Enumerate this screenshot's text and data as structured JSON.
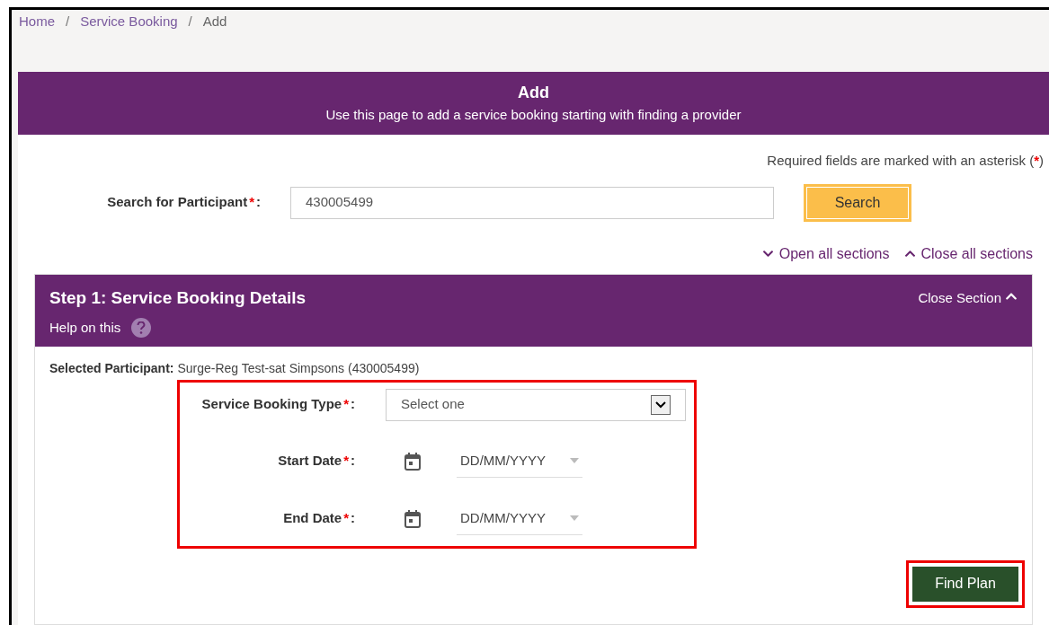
{
  "breadcrumb": [
    {
      "label": "Home",
      "link": true
    },
    {
      "label": "Service Booking",
      "link": true
    },
    {
      "label": "Add",
      "link": false
    }
  ],
  "breadcrumb_separator": "/",
  "header": {
    "title": "Add",
    "subtitle": "Use this page to add a service booking starting with finding a provider"
  },
  "required_note": {
    "before": "Required fields are marked with an asterisk (",
    "mark": "*",
    "after": ")"
  },
  "search": {
    "label": "Search for Participant",
    "mark": "*",
    "suffix": ":",
    "value": "430005499",
    "button": "Search"
  },
  "section_links": [
    {
      "label": "Open all sections",
      "kind": "open"
    },
    {
      "label": "Close all sections",
      "kind": "close"
    }
  ],
  "section": {
    "title": "Step 1: Service Booking Details",
    "help": "Help on this",
    "close": "Close Section",
    "expanded": true,
    "participant": {
      "label": "Selected Participant:",
      "value": "Surge-Reg Test-sat Simpsons (430005499)"
    },
    "fields": [
      {
        "kind": "select",
        "label": "Service Booking Type",
        "mark": "*",
        "suffix": ":",
        "placeholder": "Select one"
      },
      {
        "kind": "date",
        "label": "Start Date",
        "mark": "*",
        "suffix": ":",
        "placeholder": "DD/MM/YYYY"
      },
      {
        "kind": "date",
        "label": "End Date",
        "mark": "*",
        "suffix": ":",
        "placeholder": "DD/MM/YYYY"
      }
    ],
    "button": "Find Plan"
  }
}
